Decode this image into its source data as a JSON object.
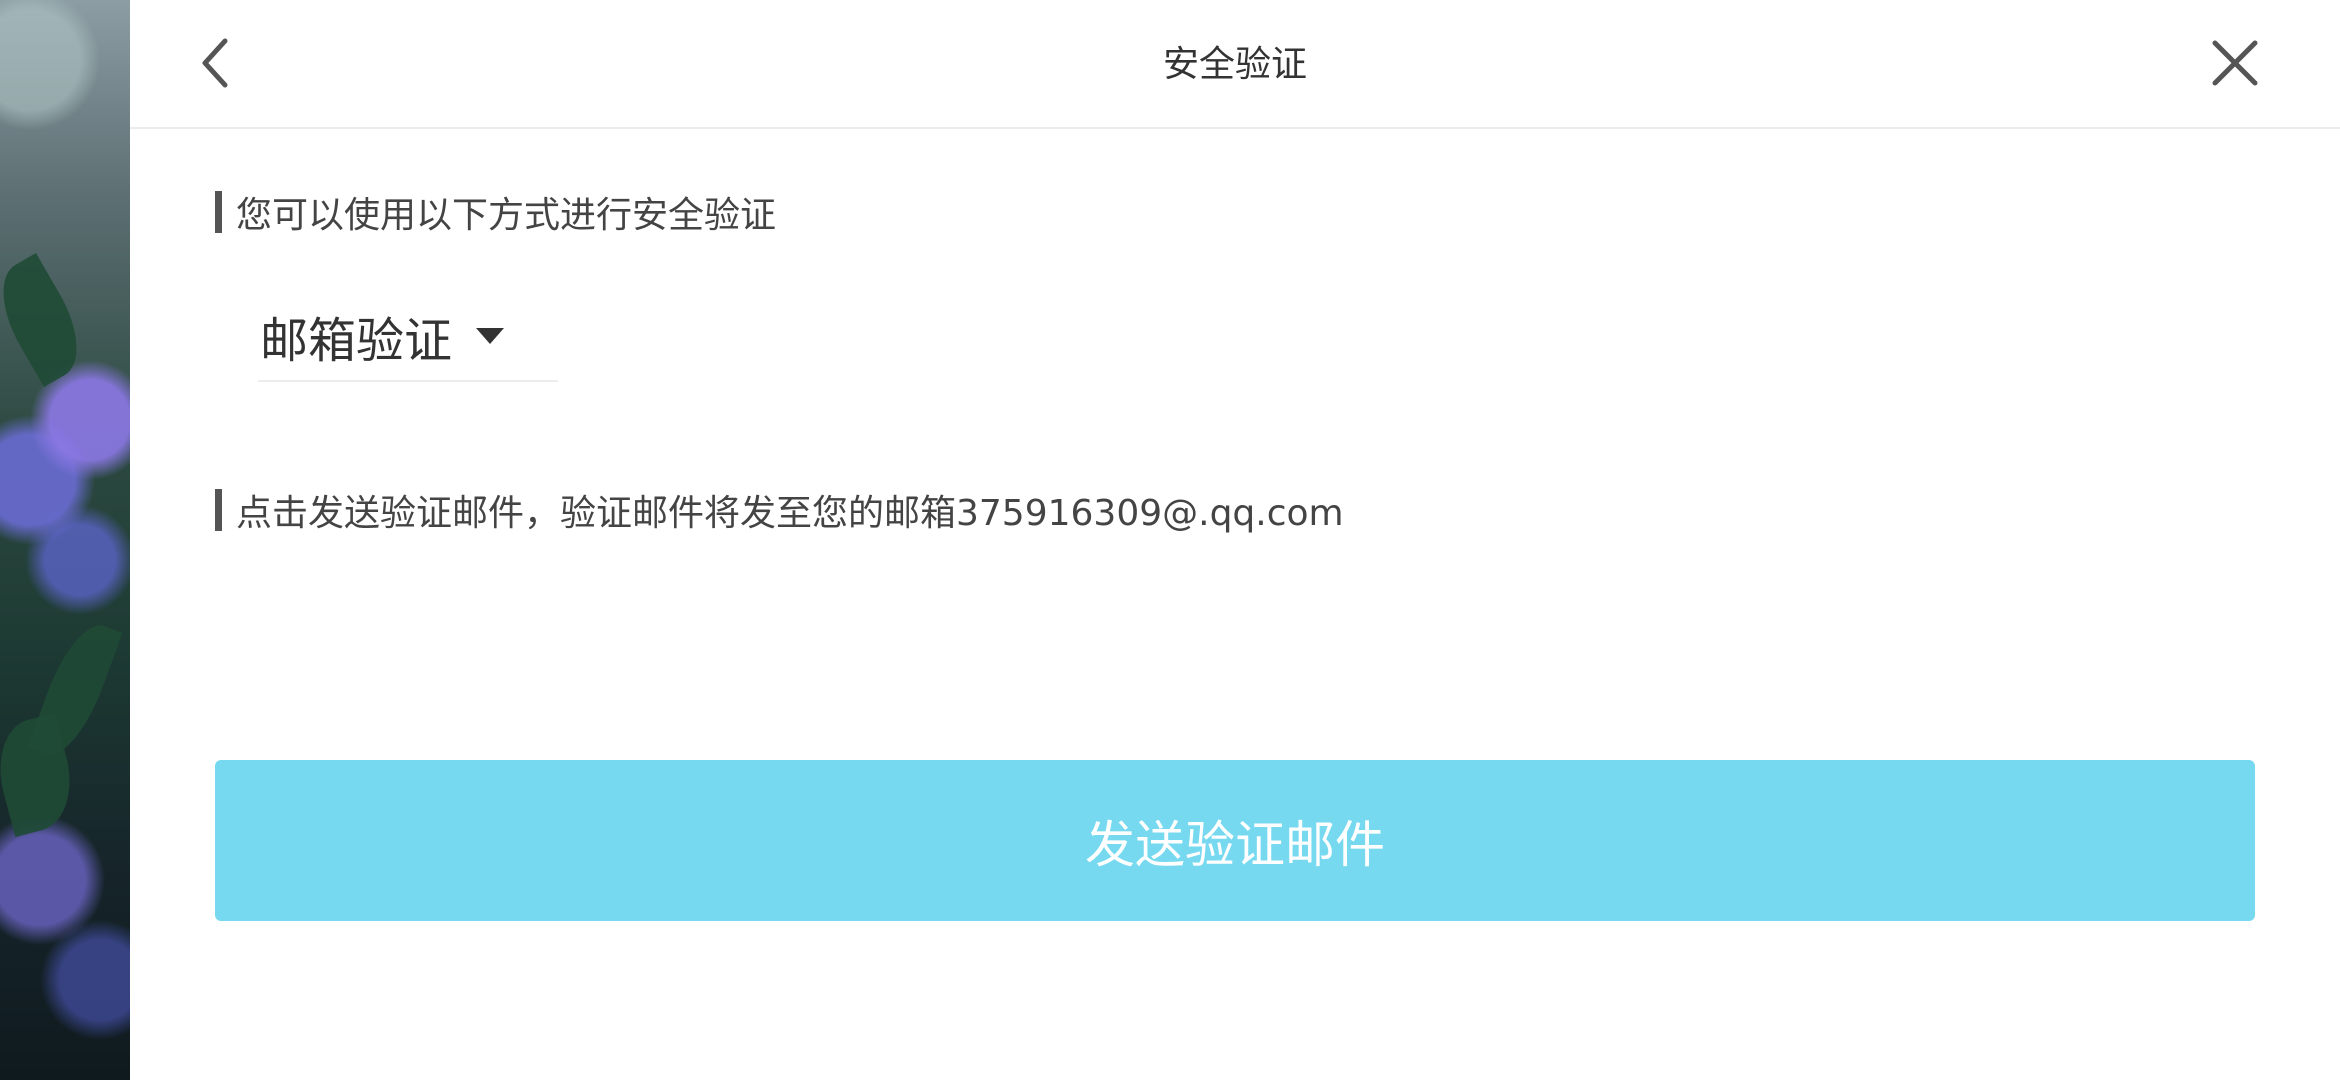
{
  "header": {
    "title": "安全验证",
    "back_icon": "chevron-left-icon",
    "close_icon": "close-icon"
  },
  "main": {
    "methods_label": "您可以使用以下方式进行安全验证",
    "method_select": {
      "value": "邮箱验证",
      "icon": "caret-down-icon"
    },
    "instruction": "点击发送验证邮件，验证邮件将发至您的邮箱375916309@.qq.com",
    "send_button_label": "发送验证邮件"
  },
  "colors": {
    "button_bg": "#76d9f0",
    "button_text": "#ffffff",
    "text": "#333333",
    "accent_bar": "#555555"
  }
}
